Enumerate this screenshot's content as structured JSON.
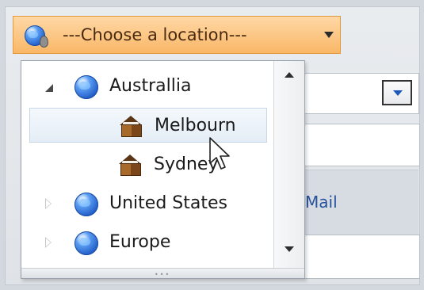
{
  "combo": {
    "placeholder": "---Choose a location---",
    "icon": "globe-pin-icon"
  },
  "tree": {
    "nodes": [
      {
        "label": "Australlia",
        "icon": "globe-icon",
        "expanded": true,
        "level": 0
      },
      {
        "label": "Melbourn",
        "icon": "building-icon",
        "selected": true,
        "level": 1
      },
      {
        "label": "Sydney",
        "icon": "building-icon",
        "level": 1
      },
      {
        "label": "United States",
        "icon": "globe-icon",
        "expanded": false,
        "level": 0
      },
      {
        "label": "Europe",
        "icon": "globe-icon",
        "expanded": false,
        "level": 0
      }
    ]
  },
  "background": {
    "label": "Mail"
  },
  "colors": {
    "combo_bg": "#f9b767",
    "combo_border": "#e49a3d",
    "selected_bg": "#e4edf6",
    "label_blue": "#27519b"
  }
}
